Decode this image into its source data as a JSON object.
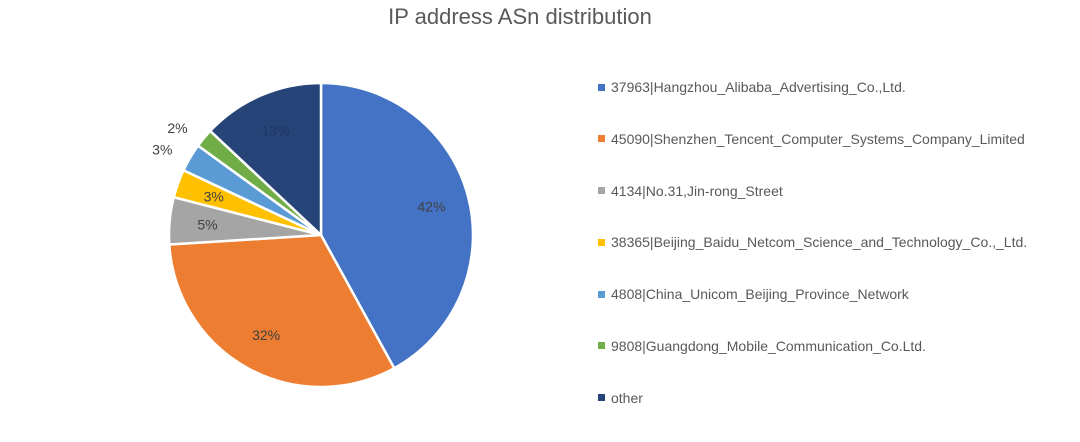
{
  "chart_data": {
    "type": "pie",
    "title": "IP address ASn distribution",
    "categories": [
      "37963|Hangzhou_Alibaba_Advertising_Co.,Ltd.",
      "45090|Shenzhen_Tencent_Computer_Systems_Company_Limited",
      "4134|No.31,Jin-rong_Street",
      "38365|Beijing_Baidu_Netcom_Science_and_Technology_Co.,_Ltd.",
      "4808|China_Unicom_Beijing_Province_Network",
      "9808|Guangdong_Mobile_Communication_Co.Ltd.",
      "other"
    ],
    "values": [
      42,
      32,
      5,
      3,
      3,
      2,
      13
    ],
    "data_labels": [
      "42%",
      "32%",
      "5%",
      "3%",
      "3%",
      "2%",
      "13%"
    ],
    "colors": [
      "#4472C4",
      "#ED7D31",
      "#A5A5A5",
      "#FFC000",
      "#5B9BD5",
      "#70AD47",
      "#264478"
    ],
    "label_colors": [
      "#404040",
      "#404040",
      "#404040",
      "#404040",
      "#404040",
      "#404040",
      "#1f3560"
    ],
    "label_placement": [
      "inside",
      "inside",
      "inside",
      "inside",
      "outside",
      "outside",
      "inside"
    ],
    "legend_position": "right"
  }
}
